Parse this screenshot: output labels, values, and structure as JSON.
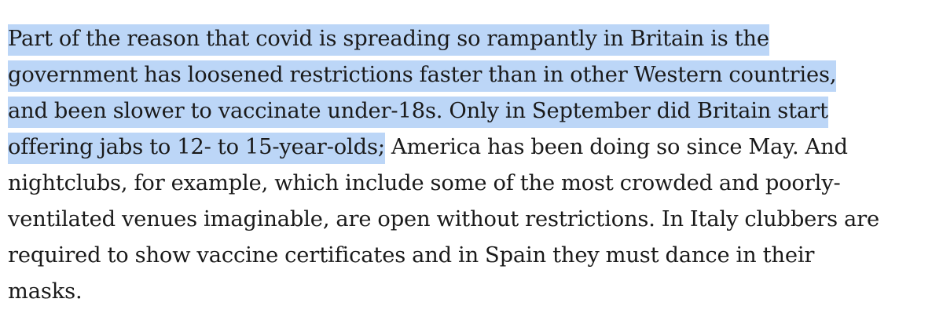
{
  "article": {
    "highlight_color": "#bcd6f7",
    "lines": [
      {
        "highlighted": "Part of the reason that covid is spreading so rampantly in Britain is the",
        "plain": ""
      },
      {
        "highlighted": "government has loosened restrictions faster than in other Western countries,",
        "plain": ""
      },
      {
        "highlighted": "and been slower to vaccinate under-18s. Only in September did Britain start",
        "plain": ""
      },
      {
        "highlighted": "offering jabs to 12- to 15-year-olds;",
        "plain": " America has been doing so since May. And"
      },
      {
        "highlighted": "",
        "plain": "nightclubs, for example, which include some of the most crowded and poorly-"
      },
      {
        "highlighted": "",
        "plain": "ventilated venues imaginable, are open without restrictions. In Italy clubbers are"
      },
      {
        "highlighted": "",
        "plain": "required to show vaccine certificates and in Spain they must dance in their"
      },
      {
        "highlighted": "",
        "plain": "masks."
      }
    ]
  }
}
